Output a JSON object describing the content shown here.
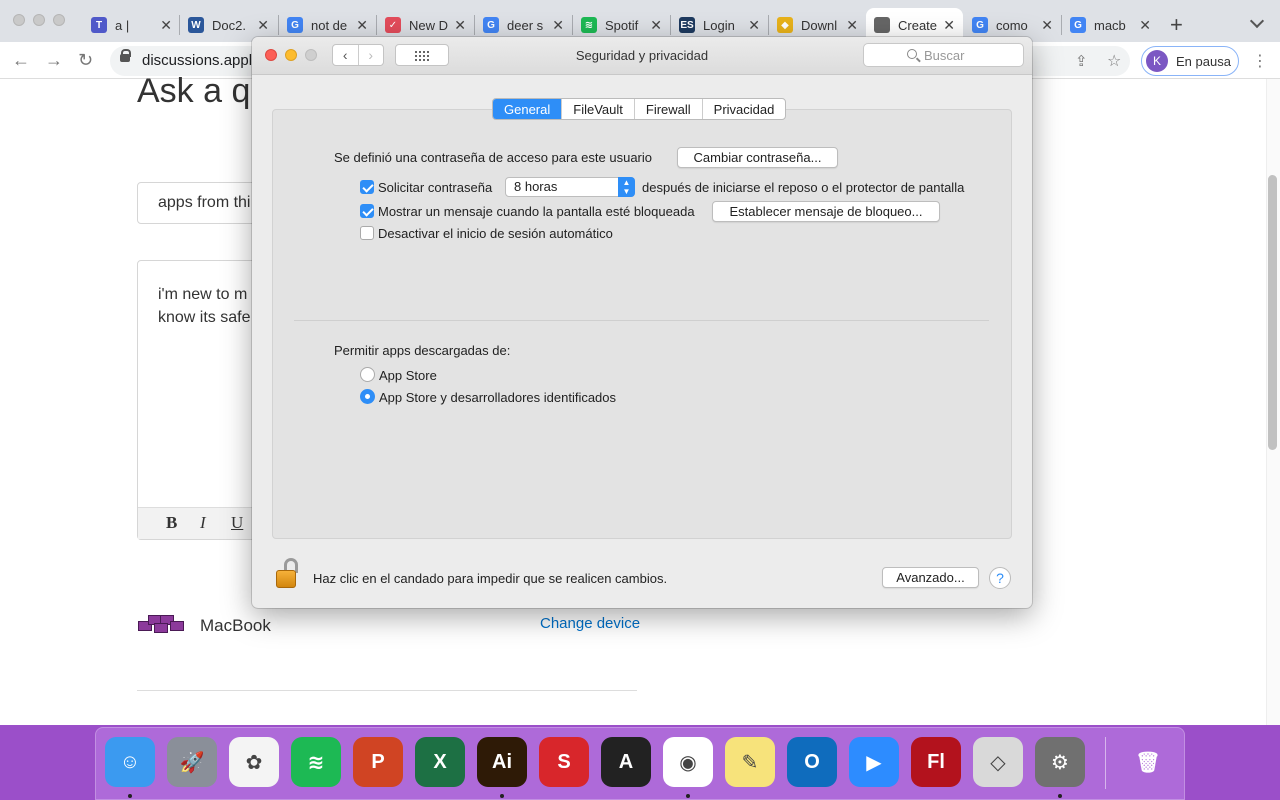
{
  "browser": {
    "tabs": [
      {
        "title": "a |",
        "fav_color": "#5059c9",
        "fav_text": "T"
      },
      {
        "title": "Doc2.",
        "fav_color": "#2b579a",
        "fav_text": "W"
      },
      {
        "title": "not de",
        "fav_color": "#4285f4",
        "fav_text": "G"
      },
      {
        "title": "New D",
        "fav_color": "#e34c5b",
        "fav_text": "✓"
      },
      {
        "title": "deer s",
        "fav_color": "#4285f4",
        "fav_text": "G"
      },
      {
        "title": "Spotif",
        "fav_color": "#1db954",
        "fav_text": "≋"
      },
      {
        "title": "Login",
        "fav_color": "#1e3a5f",
        "fav_text": "ES"
      },
      {
        "title": "Downl",
        "fav_color": "#e8b21a",
        "fav_text": "◆"
      },
      {
        "title": "Create",
        "fav_color": "#666666",
        "fav_text": ""
      },
      {
        "title": "como",
        "fav_color": "#4285f4",
        "fav_text": "G"
      },
      {
        "title": "macb",
        "fav_color": "#4285f4",
        "fav_text": "G"
      }
    ],
    "url": "discussions.apple",
    "profile_initial": "K",
    "profile_label": "En pausa"
  },
  "page": {
    "heading": "Ask a qu",
    "question_input": "apps from thi",
    "body_text": "i'm new to m\nknow its safe",
    "format_bold": "B",
    "format_italic": "I",
    "format_underline": "U",
    "device_name": "MacBook",
    "change_device": "Change device"
  },
  "window": {
    "title": "Seguridad y privacidad",
    "search_placeholder": "Buscar",
    "tabs": [
      "General",
      "FileVault",
      "Firewall",
      "Privacidad"
    ],
    "selected_tab": "General",
    "password_set_label": "Se definió una contraseña de acceso para este usuario",
    "change_password_button": "Cambiar contraseña...",
    "require_password": {
      "label": "Solicitar contraseña",
      "checked": true
    },
    "require_password_delay": "8 horas",
    "after_sleep_label": "después de iniciarse el reposo o el protector de pantalla",
    "show_message": {
      "label": "Mostrar un mensaje cuando la pantalla esté bloqueada",
      "checked": true
    },
    "set_lock_message_button": "Establecer mensaje de bloqueo...",
    "disable_auto_login": {
      "label": "Desactivar el inicio de sesión automático",
      "checked": false
    },
    "allow_apps_label": "Permitir apps descargadas de:",
    "radio_app_store": {
      "label": "App Store",
      "selected": false
    },
    "radio_identified": {
      "label": "App Store y desarrolladores identificados",
      "selected": true
    },
    "lock_text": "Haz clic en el candado para impedir que se realicen cambios.",
    "advanced_button": "Avanzado...",
    "help": "?"
  },
  "dock": {
    "apps": [
      {
        "name": "finder-icon",
        "bg": "#3b9af0",
        "text": "☺"
      },
      {
        "name": "launchpad-icon",
        "bg": "#8a8f99",
        "text": "🚀"
      },
      {
        "name": "photos-icon",
        "bg": "#f4f4f4",
        "text": "✿"
      },
      {
        "name": "spotify-icon",
        "bg": "#1db954",
        "text": "≋"
      },
      {
        "name": "powerpoint-icon",
        "bg": "#d04423",
        "text": "P"
      },
      {
        "name": "excel-icon",
        "bg": "#1d7044",
        "text": "X"
      },
      {
        "name": "illustrator-icon",
        "bg": "#2e1a06",
        "text": "Ai"
      },
      {
        "name": "sketchup-icon",
        "bg": "#d8262b",
        "text": "S"
      },
      {
        "name": "archicad-icon",
        "bg": "#222222",
        "text": "A"
      },
      {
        "name": "chrome-icon",
        "bg": "#ffffff",
        "text": "◉"
      },
      {
        "name": "stickies-icon",
        "bg": "#f7e37b",
        "text": "✎"
      },
      {
        "name": "outlook-icon",
        "bg": "#0f6cbd",
        "text": "O"
      },
      {
        "name": "zoom-icon",
        "bg": "#2d8cff",
        "text": "▶"
      },
      {
        "name": "flash-icon",
        "bg": "#b3121d",
        "text": "Fl"
      },
      {
        "name": "roblox-icon",
        "bg": "#d9d9d9",
        "text": "◇"
      },
      {
        "name": "system-preferences-icon",
        "bg": "#707070",
        "text": "⚙"
      },
      {
        "name": "trash-icon",
        "bg": "transparent",
        "text": "🗑"
      }
    ]
  }
}
